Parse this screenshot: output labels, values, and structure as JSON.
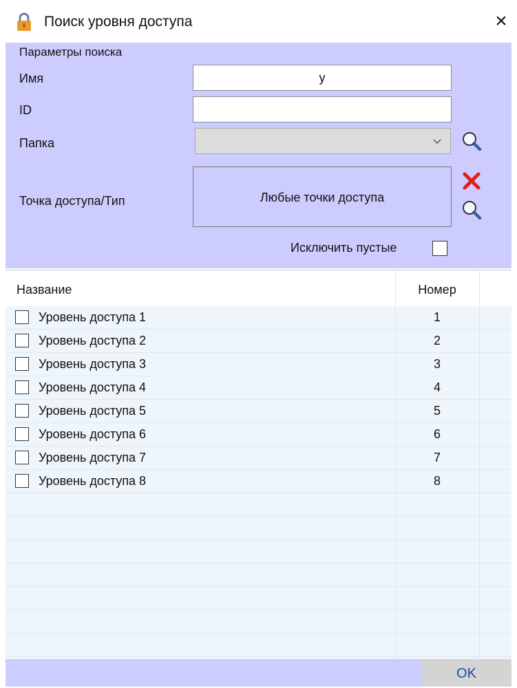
{
  "window": {
    "title": "Поиск уровня доступа",
    "close_label": "×",
    "icon": "lock-icon"
  },
  "search_params": {
    "group_label": "Параметры поиска",
    "name_label": "Имя",
    "name_value": "у",
    "id_label": "ID",
    "id_value": "",
    "folder_label": "Папка",
    "folder_value": "",
    "access_point_label": "Точка доступа/Тип",
    "access_point_value": "Любые точки доступа",
    "exclude_empty_label": "Исключить пустые",
    "exclude_empty_checked": false
  },
  "table": {
    "columns": [
      "Название",
      "Номер"
    ],
    "rows": [
      {
        "name": "Уровень доступа 1",
        "number": "1",
        "checked": false
      },
      {
        "name": "Уровень доступа 2",
        "number": "2",
        "checked": false
      },
      {
        "name": "Уровень доступа 3",
        "number": "3",
        "checked": false
      },
      {
        "name": "Уровень доступа 4",
        "number": "4",
        "checked": false
      },
      {
        "name": "Уровень доступа 5",
        "number": "5",
        "checked": false
      },
      {
        "name": "Уровень доступа 6",
        "number": "6",
        "checked": false
      },
      {
        "name": "Уровень доступа 7",
        "number": "7",
        "checked": false
      },
      {
        "name": "Уровень доступа 8",
        "number": "8",
        "checked": false
      }
    ]
  },
  "footer": {
    "ok_label": "OK"
  },
  "colors": {
    "panel": "#ccccff",
    "row_bg": "#eef5fb",
    "delete_red": "#e0201c",
    "ok_text": "#1a4ea0"
  }
}
